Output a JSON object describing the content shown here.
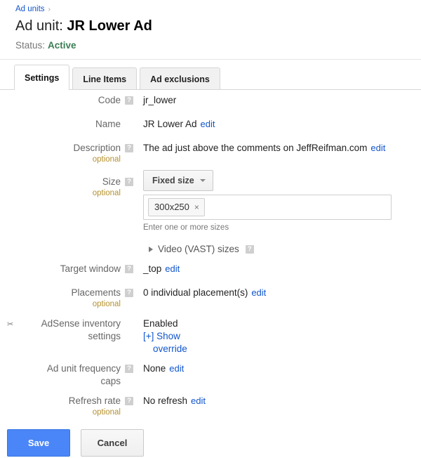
{
  "breadcrumb": {
    "link_label": "Ad units",
    "separator": "›"
  },
  "header": {
    "title_prefix": "Ad unit:",
    "title_name": "JR Lower Ad",
    "status_label": "Status:",
    "status_value": "Active",
    "status_color": "#3a7d54"
  },
  "tabs": [
    {
      "label": "Settings",
      "active": true
    },
    {
      "label": "Line Items",
      "active": false
    },
    {
      "label": "Ad exclusions",
      "active": false
    }
  ],
  "help_icon_glyph": "?",
  "fields": {
    "code": {
      "label": "Code",
      "value": "jr_lower"
    },
    "name": {
      "label": "Name",
      "value": "JR Lower Ad",
      "edit_label": "edit"
    },
    "description": {
      "label": "Description",
      "optional_label": "optional",
      "value": "The ad just above the comments on JeffReifman.com",
      "edit_label": "edit"
    },
    "size": {
      "label": "Size",
      "optional_label": "optional",
      "mode_button_label": "Fixed size",
      "chip_value": "300x250",
      "chip_remove_glyph": "×",
      "hint": "Enter one or more sizes",
      "vast_label": "Video (VAST) sizes"
    },
    "target_window": {
      "label": "Target window",
      "value": "_top",
      "edit_label": "edit"
    },
    "placements": {
      "label": "Placements",
      "optional_label": "optional",
      "value": "0 individual placement(s)",
      "edit_label": "edit"
    },
    "adsense": {
      "glyph": "✂",
      "label": "AdSense inventory settings",
      "value": "Enabled",
      "show_override_line1": "[+] Show",
      "show_override_line2": "override"
    },
    "frequency_caps": {
      "label_line1": "Ad unit frequency",
      "label_line2": "caps",
      "value": "None",
      "edit_label": "edit"
    },
    "refresh_rate": {
      "label": "Refresh rate",
      "optional_label": "optional",
      "value": "No refresh",
      "edit_label": "edit"
    }
  },
  "footer": {
    "save_label": "Save",
    "cancel_label": "Cancel",
    "save_color": "#4a86f7"
  }
}
